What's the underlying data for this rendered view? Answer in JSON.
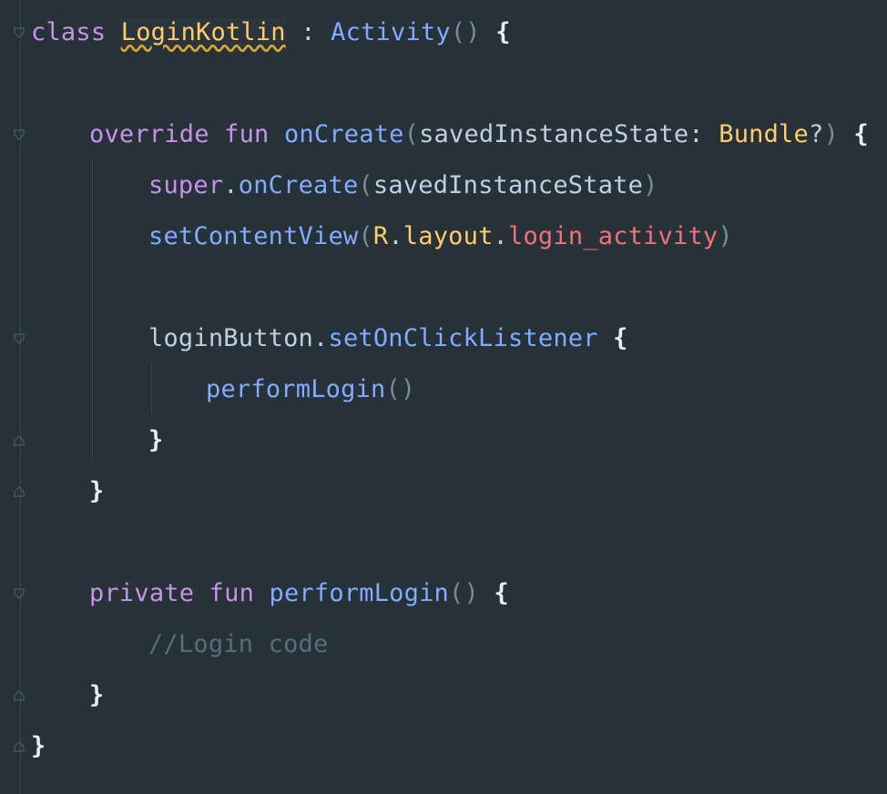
{
  "editor": {
    "language": "Kotlin",
    "theme": {
      "background": "#263238",
      "keyword": "#c792ea",
      "function": "#82aaff",
      "type": "#ffcb6b",
      "resource": "#f07178",
      "comment": "#546e7a",
      "text": "#c3cee3"
    },
    "code": {
      "l1": {
        "kw_class": "class",
        "class_name": "LoginKotlin",
        "colon": ":",
        "super_type": "Activity",
        "parens": "()",
        "brace": "{"
      },
      "l3": {
        "kw_override": "override",
        "kw_fun": "fun",
        "fn_name": "onCreate",
        "open_paren": "(",
        "param": "savedInstanceState",
        "colon": ":",
        "param_type": "Bundle",
        "nullable": "?",
        "close_paren": ")",
        "brace": "{"
      },
      "l4": {
        "kw_super": "super",
        "dot": ".",
        "fn_name": "onCreate",
        "open_paren": "(",
        "arg": "savedInstanceState",
        "close_paren": ")"
      },
      "l5": {
        "fn_name": "setContentView",
        "open_paren": "(",
        "r": "R",
        "dot1": ".",
        "layout": "layout",
        "dot2": ".",
        "resource": "login_activity",
        "close_paren": ")"
      },
      "l7": {
        "receiver": "loginButton",
        "dot": ".",
        "fn_name": "setOnClickListener",
        "brace": "{"
      },
      "l8": {
        "fn_name": "performLogin",
        "parens": "()"
      },
      "l9": {
        "brace": "}"
      },
      "l10": {
        "brace": "}"
      },
      "l12": {
        "kw_private": "private",
        "kw_fun": "fun",
        "fn_name": "performLogin",
        "parens": "()",
        "brace": "{"
      },
      "l13": {
        "comment": "//Login code"
      },
      "l14": {
        "brace": "}"
      },
      "l15": {
        "brace": "}"
      }
    },
    "fold_markers": [
      "fold-open-icon",
      "fold-open-icon",
      "fold-open-icon",
      "fold-close-icon",
      "fold-close-icon",
      "fold-open-icon",
      "fold-close-icon",
      "fold-close-icon"
    ]
  }
}
